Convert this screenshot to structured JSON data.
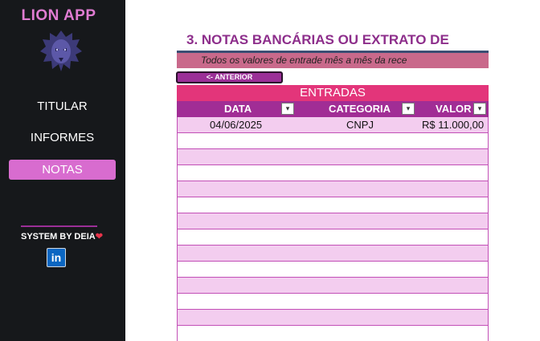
{
  "app": {
    "title": "LION APP"
  },
  "sidebar": {
    "items": [
      {
        "label": "TITULAR",
        "active": false
      },
      {
        "label": "INFORMES",
        "active": false
      },
      {
        "label": "NOTAS",
        "active": true
      }
    ],
    "credit": "SYSTEM BY DEIA",
    "credit_heart": "❤",
    "linkedin": "in"
  },
  "main": {
    "title": "3. NOTAS BANCÁRIAS OU EXTRATO DE",
    "info": "Todos os valores de entrade mês a mês da rece",
    "prev_button": "<- ANTERIOR",
    "section": "ENTRADAS",
    "columns": [
      "DATA",
      "CATEGORIA",
      "VALOR"
    ],
    "filter_icon": "▾",
    "rows": [
      {
        "data": "04/06/2025",
        "categoria": "CNPJ",
        "valor": "R$ 11.000,00"
      },
      {
        "data": "",
        "categoria": "",
        "valor": ""
      },
      {
        "data": "",
        "categoria": "",
        "valor": ""
      },
      {
        "data": "",
        "categoria": "",
        "valor": ""
      },
      {
        "data": "",
        "categoria": "",
        "valor": ""
      },
      {
        "data": "",
        "categoria": "",
        "valor": ""
      },
      {
        "data": "",
        "categoria": "",
        "valor": ""
      },
      {
        "data": "",
        "categoria": "",
        "valor": ""
      },
      {
        "data": "",
        "categoria": "",
        "valor": ""
      },
      {
        "data": "",
        "categoria": "",
        "valor": ""
      },
      {
        "data": "",
        "categoria": "",
        "valor": ""
      },
      {
        "data": "",
        "categoria": "",
        "valor": ""
      },
      {
        "data": "",
        "categoria": "",
        "valor": ""
      },
      {
        "data": "",
        "categoria": "",
        "valor": ""
      }
    ]
  },
  "colors": {
    "accent": "#d86ccf",
    "header_pink": "#e3357a",
    "table_head": "#a12d95",
    "row_pink": "#f3cdef"
  }
}
